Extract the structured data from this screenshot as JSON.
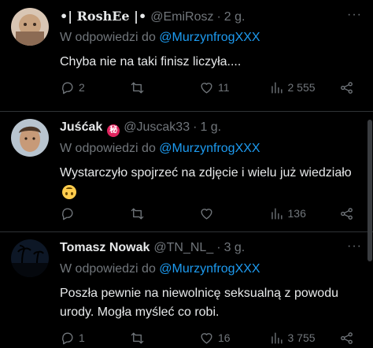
{
  "tweets": [
    {
      "display_name": "•| RoshEe |•",
      "handle": "@EmiRosz",
      "separator": "·",
      "time": "2 g.",
      "more": "···",
      "reply_prefix": "W odpowiedzi do",
      "reply_mention": "@MurzynfrogXXX",
      "text": "Chyba nie na taki finisz liczyła....",
      "replies": "2",
      "retweets": "",
      "likes": "11",
      "views": "2 555"
    },
    {
      "display_name": "Juśćak",
      "badge": "秘",
      "handle": "@Juscak33",
      "separator": "·",
      "time": "1 g.",
      "more": "",
      "reply_prefix": "W odpowiedzi do",
      "reply_mention": "@MurzynfrogXXX",
      "text": "Wystarczyło spojrzeć na zdjęcie i wielu już wiedziało",
      "emoji": "upside-down-face",
      "replies": "",
      "retweets": "",
      "likes": "",
      "views": "136"
    },
    {
      "display_name": "Tomasz Nowak",
      "handle": "@TN_NL_",
      "separator": "·",
      "time": "3 g.",
      "more": "···",
      "reply_prefix": "W odpowiedzi do",
      "reply_mention": "@MurzynfrogXXX",
      "text": "Poszła pewnie na niewolnicę seksualną z powodu urody. Mogła myśleć co robi.",
      "replies": "1",
      "retweets": "",
      "likes": "16",
      "views": "3 755"
    }
  ],
  "colors": {
    "background": "#000000",
    "text": "#e7e9ea",
    "muted": "#71767b",
    "link": "#1d9bf0",
    "divider": "#2f3336"
  }
}
